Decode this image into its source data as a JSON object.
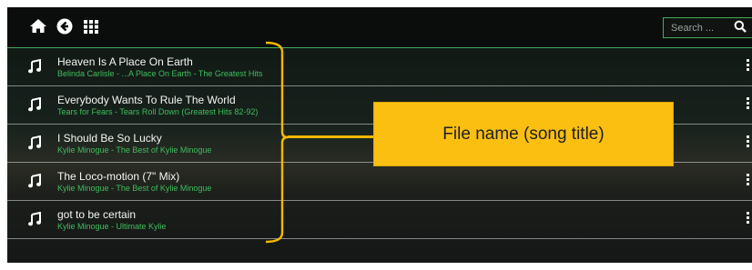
{
  "toolbar": {
    "home_icon": "home-icon",
    "back_icon": "back-circle-icon",
    "grid_icon": "grid-icon",
    "search": {
      "placeholder": "Search ...",
      "value": "",
      "icon": "search-icon"
    }
  },
  "tracks": [
    {
      "title": "Heaven Is A Place On Earth",
      "subtitle": "Belinda Carlisle - ...A Place On Earth - The Greatest Hits"
    },
    {
      "title": "Everybody Wants To Rule The World",
      "subtitle": "Tears for Fears - Tears Roll Down (Greatest Hits 82-92)"
    },
    {
      "title": "I Should Be So Lucky",
      "subtitle": "Kylie Minogue - The Best of Kylie Minogue"
    },
    {
      "title": "The Loco-motion (7\" Mix)",
      "subtitle": "Kylie Minogue - The Best of Kylie Minogue"
    },
    {
      "title": "got to be certain",
      "subtitle": "Kylie Minogue - Ultimate Kylie"
    }
  ],
  "annotation": {
    "label": "File name (song title)"
  },
  "colors": {
    "accent": "#3fae5a",
    "subtitle": "#3fbf5c",
    "callout": "#fbbf12"
  }
}
